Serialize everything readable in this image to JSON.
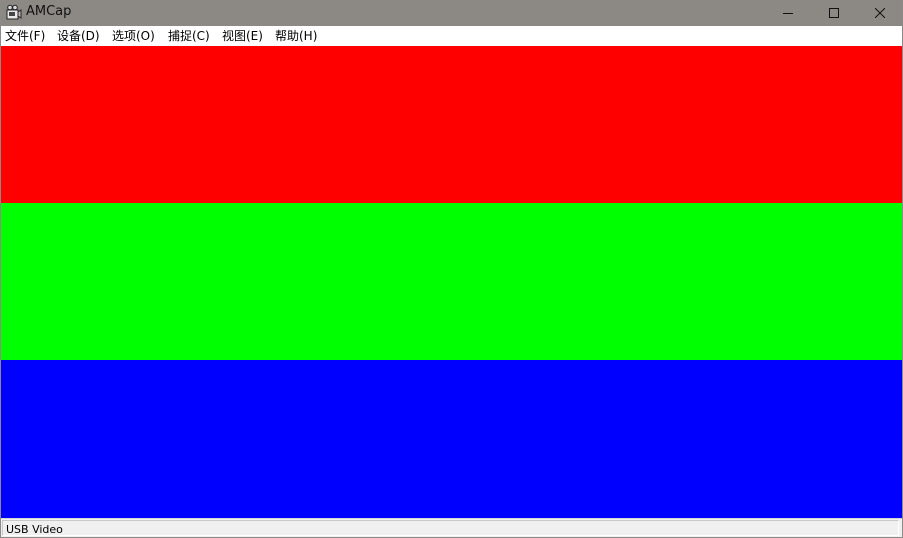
{
  "window": {
    "title": "AMCap",
    "title_bar_color": "#8c8985"
  },
  "menu": {
    "items": [
      {
        "label": "文件(F)",
        "mnemonic": "F"
      },
      {
        "label": "设备(D)",
        "mnemonic": "D"
      },
      {
        "label": "选项(O)",
        "mnemonic": "O"
      },
      {
        "label": "捕捉(C)",
        "mnemonic": "C"
      },
      {
        "label": "视图(E)",
        "mnemonic": "E"
      },
      {
        "label": "帮助(H)",
        "mnemonic": "H"
      }
    ]
  },
  "video": {
    "bars": [
      {
        "name": "red",
        "color": "#ff0000"
      },
      {
        "name": "green",
        "color": "#00ff00"
      },
      {
        "name": "blue",
        "color": "#0000ff"
      }
    ]
  },
  "status": {
    "text": "USB Video"
  },
  "icons": {
    "app": "camera-app-icon",
    "minimize": "minimize-icon",
    "maximize": "maximize-icon",
    "close": "close-icon"
  }
}
